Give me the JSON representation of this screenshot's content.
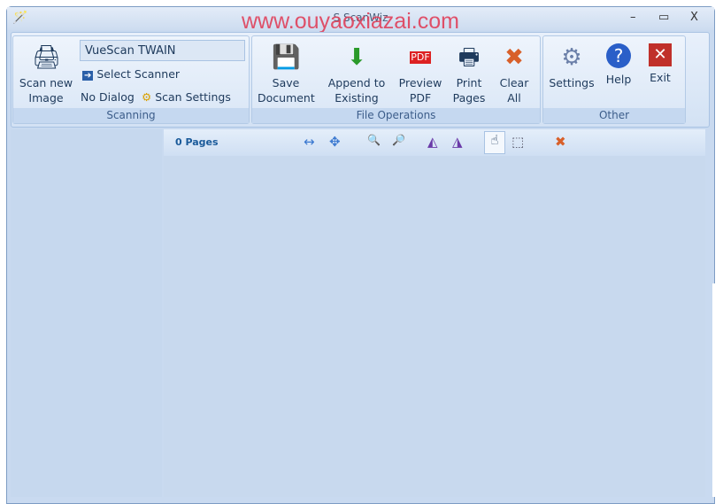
{
  "window": {
    "watermark": "www.ouyaoxiazai.com",
    "title_partial": "S  ScanWiz",
    "minimize": "–",
    "maximize": "▭",
    "close": "X"
  },
  "ribbon": {
    "scanning": {
      "label": "Scanning",
      "scan_new": "Scan new",
      "scan_new2": "Image",
      "scanner_name": "VueScan TWAIN",
      "select_scanner": "Select Scanner",
      "no_dialog": "No Dialog",
      "scan_settings": "Scan Settings"
    },
    "file_ops": {
      "label": "File Operations",
      "save": [
        "Save",
        "Document"
      ],
      "append": [
        "Append to",
        "Existing PDF"
      ],
      "preview": [
        "Preview",
        "PDF"
      ],
      "print": [
        "Print",
        "Pages"
      ],
      "clear": [
        "Clear",
        "All"
      ]
    },
    "other": {
      "label": "Other",
      "settings": "Settings",
      "help": "Help",
      "exit": "Exit"
    }
  },
  "viewer": {
    "pages": "0 Pages"
  }
}
